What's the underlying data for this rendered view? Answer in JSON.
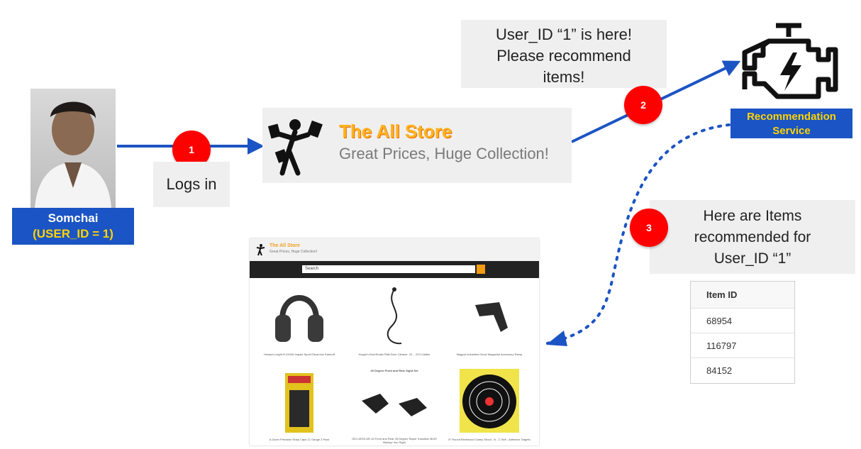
{
  "user": {
    "name": "Somchai",
    "id_label": "(USER_ID = 1)"
  },
  "steps": [
    {
      "number": "1",
      "label": "Logs in"
    },
    {
      "number": "2",
      "label": "User_ID “1” is here! Please recommend items!",
      "lines": [
        "User_ID “1” is here!",
        "Please recommend",
        "items!"
      ]
    },
    {
      "number": "3",
      "label": "Here are Items recommended for User_ID “1”",
      "lines": [
        "Here are Items",
        "recommended for",
        "User_ID “1”"
      ]
    }
  ],
  "store": {
    "title": "The All Store",
    "tagline": "Great Prices, Huge Collection!"
  },
  "service": {
    "label_line1": "Recommendation",
    "label_line2": "Service"
  },
  "screenshot": {
    "title": "The All Store",
    "tagline": "Great Prices, Huge Collection!",
    "search_placeholder": "Search",
    "products": [
      "Howard Leight R-01526 Impact Sport Electronic Earmuff",
      "Hoppe's BoreSnake Rifle Bore Cleaner .22 - .223 Caliber",
      "Magpul Industries Glock Magazine Accessory Ramp"
    ],
    "products_row2": [
      "A-Zoom Precision Snap Caps 12 Gauge 2 Pack",
      "GD1 AR15 AR-15 Front and Rear 45 Degree Rapid Transition BUIS Backup Iron Sight",
      "8\" Round Birchwood Casey Shoot - N - C Self - Adhesive Targets"
    ],
    "row2_heading": "45 Degree Front and Rear Sight Set"
  },
  "table": {
    "header": "Item ID",
    "rows": [
      "68954",
      "116797",
      "84152"
    ]
  },
  "colors": {
    "arrow": "#1b54c4",
    "badge": "#ff0000",
    "label_bg": "#1b54c4",
    "label_text": "#ffd400"
  }
}
